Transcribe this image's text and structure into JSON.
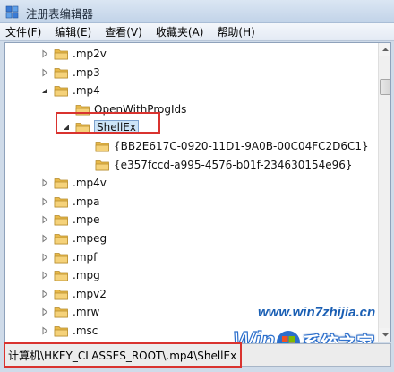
{
  "window": {
    "title": "注册表编辑器"
  },
  "menu": [
    {
      "label": "文件(F)"
    },
    {
      "label": "编辑(E)"
    },
    {
      "label": "查看(V)"
    },
    {
      "label": "收藏夹(A)"
    },
    {
      "label": "帮助(H)"
    }
  ],
  "tree": {
    "rows": [
      {
        "label": ".mp2v",
        "expander": "collapsed",
        "level": 0
      },
      {
        "label": ".mp3",
        "expander": "collapsed",
        "level": 0
      },
      {
        "label": ".mp4",
        "expander": "expanded",
        "level": 0
      },
      {
        "label": "OpenWithProgIds",
        "expander": "none",
        "level": 1
      },
      {
        "label": "ShellEx",
        "expander": "expanded",
        "level": 1,
        "selected": true
      },
      {
        "label": "{BB2E617C-0920-11D1-9A0B-00C04FC2D6C1}",
        "expander": "none",
        "level": 2
      },
      {
        "label": "{e357fccd-a995-4576-b01f-234630154e96}",
        "expander": "none",
        "level": 2
      },
      {
        "label": ".mp4v",
        "expander": "collapsed",
        "level": 0
      },
      {
        "label": ".mpa",
        "expander": "collapsed",
        "level": 0
      },
      {
        "label": ".mpe",
        "expander": "collapsed",
        "level": 0
      },
      {
        "label": ".mpeg",
        "expander": "collapsed",
        "level": 0
      },
      {
        "label": ".mpf",
        "expander": "collapsed",
        "level": 0
      },
      {
        "label": ".mpg",
        "expander": "collapsed",
        "level": 0
      },
      {
        "label": ".mpv2",
        "expander": "collapsed",
        "level": 0
      },
      {
        "label": ".mrw",
        "expander": "collapsed",
        "level": 0
      },
      {
        "label": ".msc",
        "expander": "collapsed",
        "level": 0
      }
    ]
  },
  "status": {
    "path": "计算机\\HKEY_CLASSES_ROOT\\.mp4\\ShellEx"
  },
  "watermark": {
    "url": "www.win7zhijia.cn",
    "text": "系统之家"
  },
  "colors": {
    "highlight": "#d9332f",
    "folder": "#e8b94a",
    "selected": "#cce4f7"
  }
}
